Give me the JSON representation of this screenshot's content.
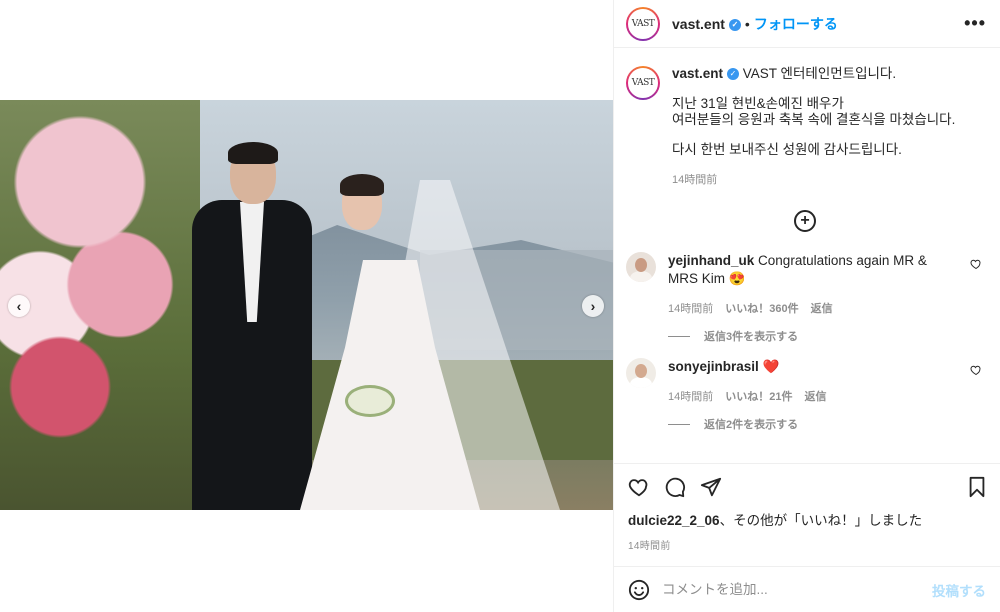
{
  "post": {
    "username": "vast.ent",
    "avatar_text": "VAST",
    "follow_label": "フォローする",
    "separator": "•",
    "more_label": "•••"
  },
  "caption": {
    "username": "vast.ent",
    "line1": "VAST 엔터테인먼트입니다.",
    "line2": "지난 31일 현빈&손예진 배우가",
    "line3": "여러분들의 응원과 축복 속에 결혼식을 마쳤습니다.",
    "line4": "다시 한번 보내주신 성원에 감사드립니다.",
    "time": "14時間前"
  },
  "comments": [
    {
      "username": "yejinhand_uk",
      "text": "Congratulations again MR & MRS Kim 😍",
      "time": "14時間前",
      "likes": "いいね！360件",
      "reply_label": "返信",
      "replies_label": "返信3件を表示する"
    },
    {
      "username": "sonyejinbrasil",
      "text": "❤️",
      "time": "14時間前",
      "likes": "いいね！21件",
      "reply_label": "返信",
      "replies_label": "返信2件を表示する"
    }
  ],
  "footer": {
    "liked_by_user": "dulcie22_2_06",
    "liked_by_suffix": "、その他が「いいね！」しました",
    "time": "14時間前",
    "comment_placeholder": "コメントを追加...",
    "post_label": "投稿する"
  },
  "colors": {
    "accent": "#0095f6",
    "post_disabled": "#b2dffc",
    "muted": "#8e8e8e"
  }
}
